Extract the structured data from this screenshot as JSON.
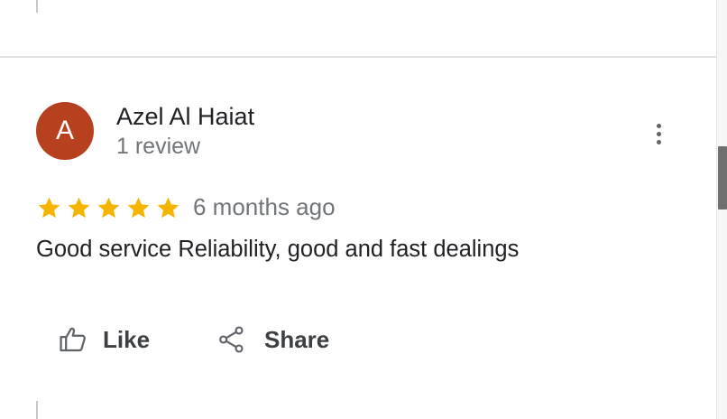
{
  "review": {
    "author": {
      "initial": "A",
      "name": "Azel Al Haiat",
      "review_count": "1 review",
      "avatar_color": "#b7401f"
    },
    "rating": 5,
    "rating_max": 5,
    "star_color": "#f4b400",
    "time_ago": "6 months ago",
    "text": "Good service Reliability, good and fast dealings",
    "more_icon": "more-vert-icon"
  },
  "actions": {
    "like_label": "Like",
    "like_icon": "thumb-up-icon",
    "share_label": "Share",
    "share_icon": "share-icon"
  }
}
